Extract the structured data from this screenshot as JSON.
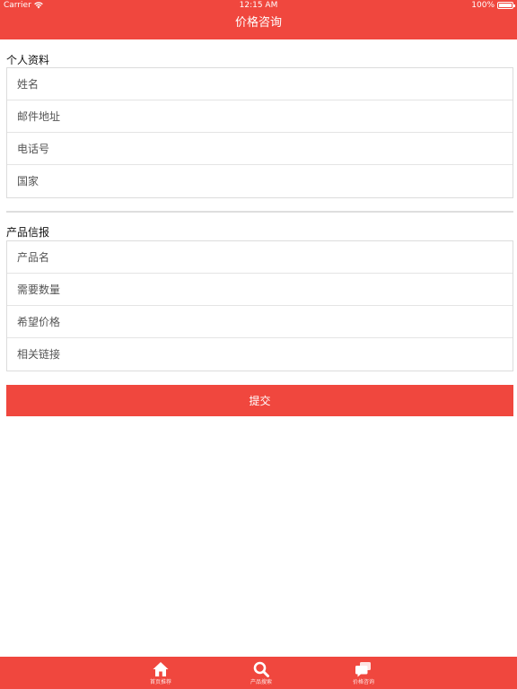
{
  "status": {
    "carrier": "Carrier",
    "time": "12:15 AM",
    "battery": "100%",
    "battery_level": 1.0
  },
  "nav": {
    "title": "价格咨询"
  },
  "personal": {
    "title": "个人资料",
    "fields": {
      "name": "姓名",
      "email": "邮件地址",
      "phone": "电话号",
      "country": "国家"
    }
  },
  "product": {
    "title": "产品信报",
    "fields": {
      "product_name": "产品名",
      "quantity": "需要数量",
      "price": "希望价格",
      "link": "相关链接"
    }
  },
  "submit_label": "提交",
  "tabs": [
    {
      "label": "首页推荐",
      "icon": "home-icon"
    },
    {
      "label": "产品搜索",
      "icon": "search-icon"
    },
    {
      "label": "价格咨询",
      "icon": "chat-icon"
    }
  ],
  "colors": {
    "accent": "#f0473e"
  }
}
